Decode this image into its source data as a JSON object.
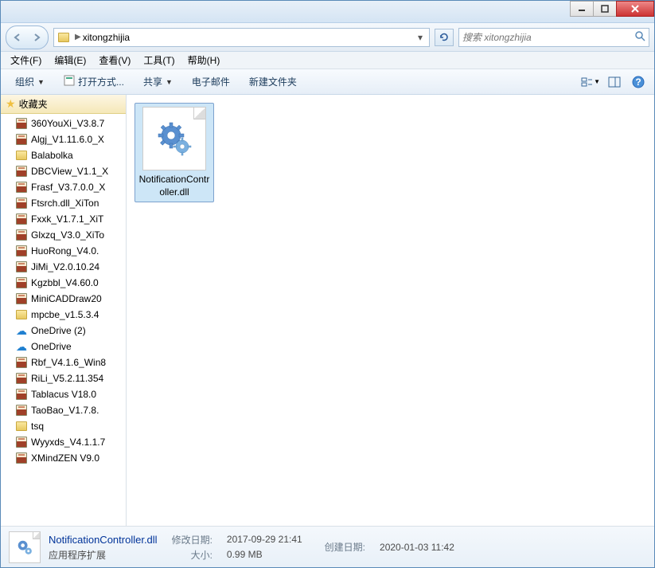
{
  "address": {
    "path": "xitongzhijia"
  },
  "search": {
    "placeholder": "搜索 xitongzhijia"
  },
  "menu": {
    "file": "文件(F)",
    "edit": "编辑(E)",
    "view": "查看(V)",
    "tools": "工具(T)",
    "help": "帮助(H)"
  },
  "toolbar": {
    "organize": "组织",
    "open_with": "打开方式...",
    "share": "共享",
    "email": "电子邮件",
    "new_folder": "新建文件夹"
  },
  "sidebar": {
    "favorites_label": "收藏夹",
    "items": [
      {
        "label": "360YouXi_V3.8.7",
        "icon": "rar"
      },
      {
        "label": "Algj_V1.11.6.0_X",
        "icon": "rar"
      },
      {
        "label": "Balabolka",
        "icon": "folder"
      },
      {
        "label": "DBCView_V1.1_X",
        "icon": "rar"
      },
      {
        "label": "Frasf_V3.7.0.0_X",
        "icon": "rar"
      },
      {
        "label": "Ftsrch.dll_XiTon",
        "icon": "rar"
      },
      {
        "label": "Fxxk_V1.7.1_XiT",
        "icon": "rar"
      },
      {
        "label": "Glxzq_V3.0_XiTo",
        "icon": "rar"
      },
      {
        "label": "HuoRong_V4.0.",
        "icon": "rar"
      },
      {
        "label": "JiMi_V2.0.10.24",
        "icon": "rar"
      },
      {
        "label": "Kgzbbl_V4.60.0",
        "icon": "rar"
      },
      {
        "label": "MiniCADDraw20",
        "icon": "rar"
      },
      {
        "label": "mpcbe_v1.5.3.4",
        "icon": "folder"
      },
      {
        "label": "OneDrive (2)",
        "icon": "onedrive"
      },
      {
        "label": "OneDrive",
        "icon": "onedrive"
      },
      {
        "label": "Rbf_V4.1.6_Win8",
        "icon": "rar"
      },
      {
        "label": "RiLi_V5.2.11.354",
        "icon": "rar"
      },
      {
        "label": "Tablacus V18.0",
        "icon": "rar"
      },
      {
        "label": "TaoBao_V1.7.8.",
        "icon": "rar"
      },
      {
        "label": "tsq",
        "icon": "folder"
      },
      {
        "label": "Wyyxds_V4.1.1.7",
        "icon": "rar"
      },
      {
        "label": "XMindZEN  V9.0",
        "icon": "rar"
      }
    ]
  },
  "content": {
    "file_name": "NotificationController.dll"
  },
  "details": {
    "name": "NotificationController.dll",
    "type": "应用程序扩展",
    "mod_label": "修改日期:",
    "mod_val": "2017-09-29 21:41",
    "size_label": "大小:",
    "size_val": "0.99 MB",
    "created_label": "创建日期:",
    "created_val": "2020-01-03 11:42"
  }
}
